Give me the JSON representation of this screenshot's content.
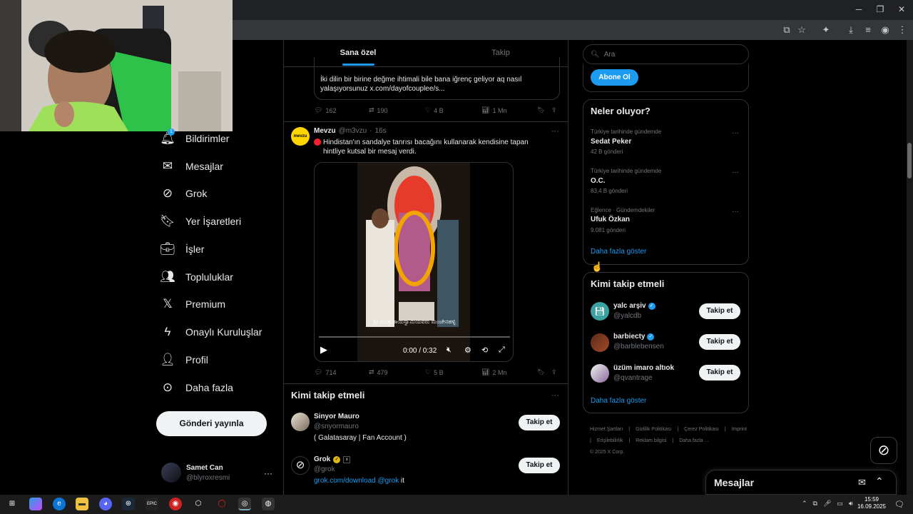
{
  "nav": {
    "notifications": {
      "label": "Bildirimler",
      "badge": "1"
    },
    "messages": "Mesajlar",
    "grok": "Grok",
    "bookmarks": "Yer İşaretleri",
    "jobs": "İşler",
    "communities": "Topluluklar",
    "premium": "Premium",
    "verified_orgs": "Onaylı Kuruluşlar",
    "profile": "Profil",
    "more": "Daha fazla",
    "post_button": "Gönderi yayınla"
  },
  "account": {
    "name": "Samet Can",
    "handle": "@blyroxresmi"
  },
  "tabs": {
    "for_you": "Sana özel",
    "following": "Takip"
  },
  "tweet1": {
    "text": "İki dilin bir birine değme ihtimali bile bana iğrenç geliyor aq nasıl yalaşıyorsunuz x.com/dayofcouplee/s...",
    "replies": "162",
    "retweets": "190",
    "likes": "4 B",
    "views": "1 Mn"
  },
  "tweet2": {
    "avatar_text": "mevzu",
    "author": "Mevzu",
    "handle": "@m3vzu",
    "time": "16s",
    "text": "Hindistan'ın sandalye tanrısı  bacağını kullanarak kendisine tapan hintliye kutsal bir mesaj verdi.",
    "video_subtitle": "ಶ್ರೀ ಮುತ್ತುರಾಯಸ್ವಾಮಿಯವರು ಮಂಜೇನಹಳ್ಳಿ",
    "video_time": "0:00 / 0:32",
    "replies": "714",
    "retweets": "479",
    "likes": "5 B",
    "views": "2 Mn"
  },
  "whotofollow_main": {
    "title": "Kimi takip etmeli",
    "items": [
      {
        "name": "Sinyor Mauro",
        "handle": "@snyormauro",
        "bio": "( Galatasaray | Fan Account )",
        "button": "Takip et"
      },
      {
        "name": "Grok",
        "handle": "@grok",
        "bio_link": "grok.com/download @grok",
        "bio_tail": " it",
        "button": "Takip et"
      }
    ]
  },
  "search": {
    "placeholder": "Ara"
  },
  "subscribe_button": "Abone Ol",
  "trends": {
    "title": "Neler oluyor?",
    "items": [
      {
        "context": "Türkiye tarihinde gündemde",
        "name": "Sedat Peker",
        "count": "42 B gönderi"
      },
      {
        "context": "Türkiye tarihinde gündemde",
        "name": "O.C.",
        "count": "83,4 B gönderi"
      },
      {
        "context": "Eğlence · Gündemdekiler",
        "name": "Ufuk Özkan",
        "count": "9.081 gönderi"
      }
    ],
    "show_more": "Daha fazla göster"
  },
  "whotofollow_side": {
    "title": "Kimi takip etmeli",
    "items": [
      {
        "name": "yalc arşiv",
        "handle": "@yalcdb",
        "button": "Takip et"
      },
      {
        "name": "barbiecty",
        "handle": "@barblebensen",
        "button": "Takip et"
      },
      {
        "name": "üzüm imaro altıok",
        "handle": "@qvantrage",
        "button": "Takip et"
      }
    ],
    "show_more": "Daha fazla göster"
  },
  "footer": {
    "links": [
      "Hizmet Şartları",
      "Gizlilik Politikası",
      "Çerez Politikası",
      "Imprint",
      "Erişilebilirlik",
      "Reklam bilgisi",
      "Daha fazla ..."
    ],
    "copyright": "© 2025 X Corp."
  },
  "messages_dock": {
    "title": "Mesajlar"
  },
  "taskbar": {
    "time": "15:59",
    "date": "16.09.2025"
  },
  "colors": {
    "accent": "#1d9bf0",
    "badge": "#1d9bf0",
    "bg": "#000000",
    "border": "#2f3336"
  }
}
